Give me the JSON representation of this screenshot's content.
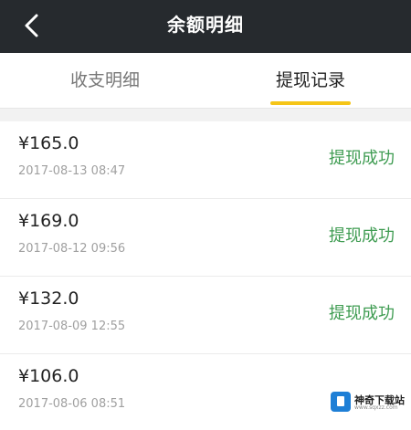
{
  "header": {
    "title": "余额明细",
    "back_icon": "chevron-left-icon"
  },
  "tabs": [
    {
      "label": "收支明细",
      "active": false
    },
    {
      "label": "提现记录",
      "active": true
    }
  ],
  "records": [
    {
      "amount": "¥165.0",
      "date": "2017-08-13 08:47",
      "status": "提现成功"
    },
    {
      "amount": "¥169.0",
      "date": "2017-08-12 09:56",
      "status": "提现成功"
    },
    {
      "amount": "¥132.0",
      "date": "2017-08-09 12:55",
      "status": "提现成功"
    },
    {
      "amount": "¥106.0",
      "date": "2017-08-06 08:51",
      "status": ""
    }
  ],
  "watermark": {
    "text": "神奇下载站",
    "sub": "www.sqxzz.com"
  },
  "colors": {
    "header_bg": "#262a2e",
    "accent": "#f5c518",
    "status_success": "#3f9c52"
  }
}
